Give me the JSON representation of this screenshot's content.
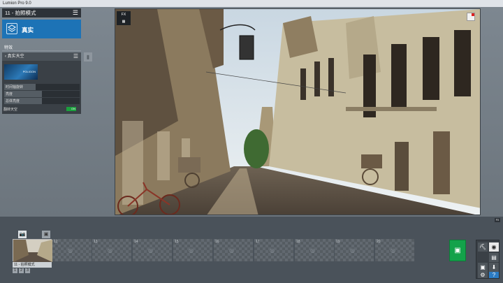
{
  "window": {
    "title": "Lumion Pro 9.0"
  },
  "mode": {
    "title": "11 - 拍照模式",
    "menu_icon": "hamburger-icon"
  },
  "real_button": {
    "label": "真实",
    "icon": "real-layers-icon"
  },
  "effects": {
    "label": "特效",
    "panel_title": "真实天空",
    "thumbnail_caption": "POLIGON",
    "sliders": [
      {
        "label": "时间轴旋转",
        "value": 0.42
      },
      {
        "label": "亮度",
        "value": 0.5
      },
      {
        "label": "总体亮度",
        "value": 0.5
      }
    ],
    "toggle": {
      "label": "翻转天空",
      "state": "ON",
      "color": "#1aa03c"
    }
  },
  "viewport": {
    "fx_badge": "FX"
  },
  "timeline": {
    "active_slot": {
      "number": "11",
      "label": "11 - 拍照模式"
    },
    "slots": [
      "12",
      "13",
      "14",
      "15",
      "16",
      "17",
      "18",
      "19",
      "20"
    ],
    "pages": [
      "1",
      "2",
      "3"
    ]
  },
  "right_panel": {
    "fx_tab": "FX",
    "help": "?"
  },
  "colors": {
    "accent": "#1d73b6",
    "render": "#13a24a"
  }
}
